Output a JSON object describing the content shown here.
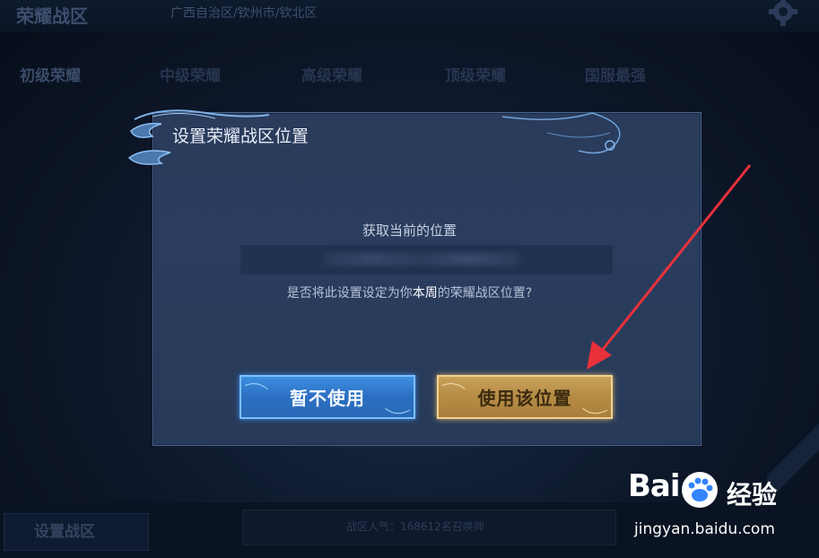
{
  "background": {
    "title": "荣耀战区",
    "location": "广西自治区/钦州市/钦北区",
    "subline": "",
    "tabs": [
      "初级荣耀",
      "中级荣耀",
      "高级荣耀",
      "顶级荣耀",
      "国服最强"
    ],
    "bottom_button": "设置战区",
    "popularity": "战区人气：168612名召唤师"
  },
  "dialog": {
    "title": "设置荣耀战区位置",
    "subtitle": "获取当前的位置",
    "confirm_prefix": "是否将此设置设定为你",
    "confirm_highlight": "本周",
    "confirm_suffix": "的荣耀战区位置?",
    "cancel_label": "暂不使用",
    "use_label": "使用该位置"
  },
  "watermark": {
    "logo_text": "Bai",
    "logo_suffix": "经验",
    "url": "jingyan.baidu.com"
  },
  "colors": {
    "cancel_button": "#2b6fc2",
    "use_button": "#b58b45",
    "arrow": "#e8313b"
  }
}
